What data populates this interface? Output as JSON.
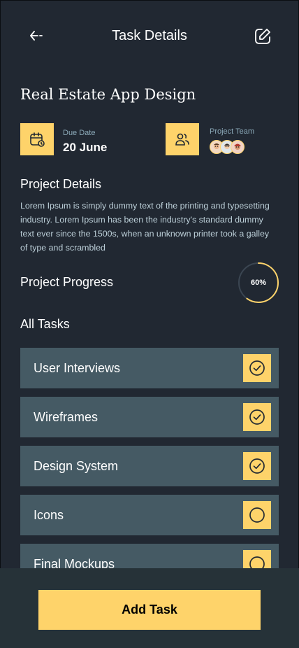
{
  "header": {
    "title": "Task Details",
    "back_icon": "back-arrow-icon",
    "edit_icon": "edit-icon"
  },
  "project": {
    "title": "Real Estate App Design",
    "due_date": {
      "label": "Due Date",
      "value": "20 June",
      "icon": "calendar-icon"
    },
    "team": {
      "label": "Project Team",
      "icon": "users-icon",
      "member_count": 3
    }
  },
  "details": {
    "title": "Project Details",
    "text": "Lorem Ipsum is simply dummy text of the printing and typesetting industry. Lorem Ipsum has been the industry's standard dummy text ever since the 1500s, when an unknown printer took a galley of type and scrambled"
  },
  "progress": {
    "title": "Project Progress",
    "label": "60%",
    "value": 0.6
  },
  "tasks": {
    "title": "All Tasks",
    "items": [
      {
        "label": "User Interviews",
        "done": true
      },
      {
        "label": "Wireframes",
        "done": true
      },
      {
        "label": "Design System",
        "done": true
      },
      {
        "label": "Icons",
        "done": false
      },
      {
        "label": "Final Mockups",
        "done": false
      }
    ]
  },
  "actions": {
    "add_task_label": "Add Task"
  },
  "colors": {
    "background": "#212832",
    "accent": "#FED36A",
    "card": "#455A64",
    "bottom_bar": "#263238",
    "muted_text": "#8CAAB9"
  }
}
